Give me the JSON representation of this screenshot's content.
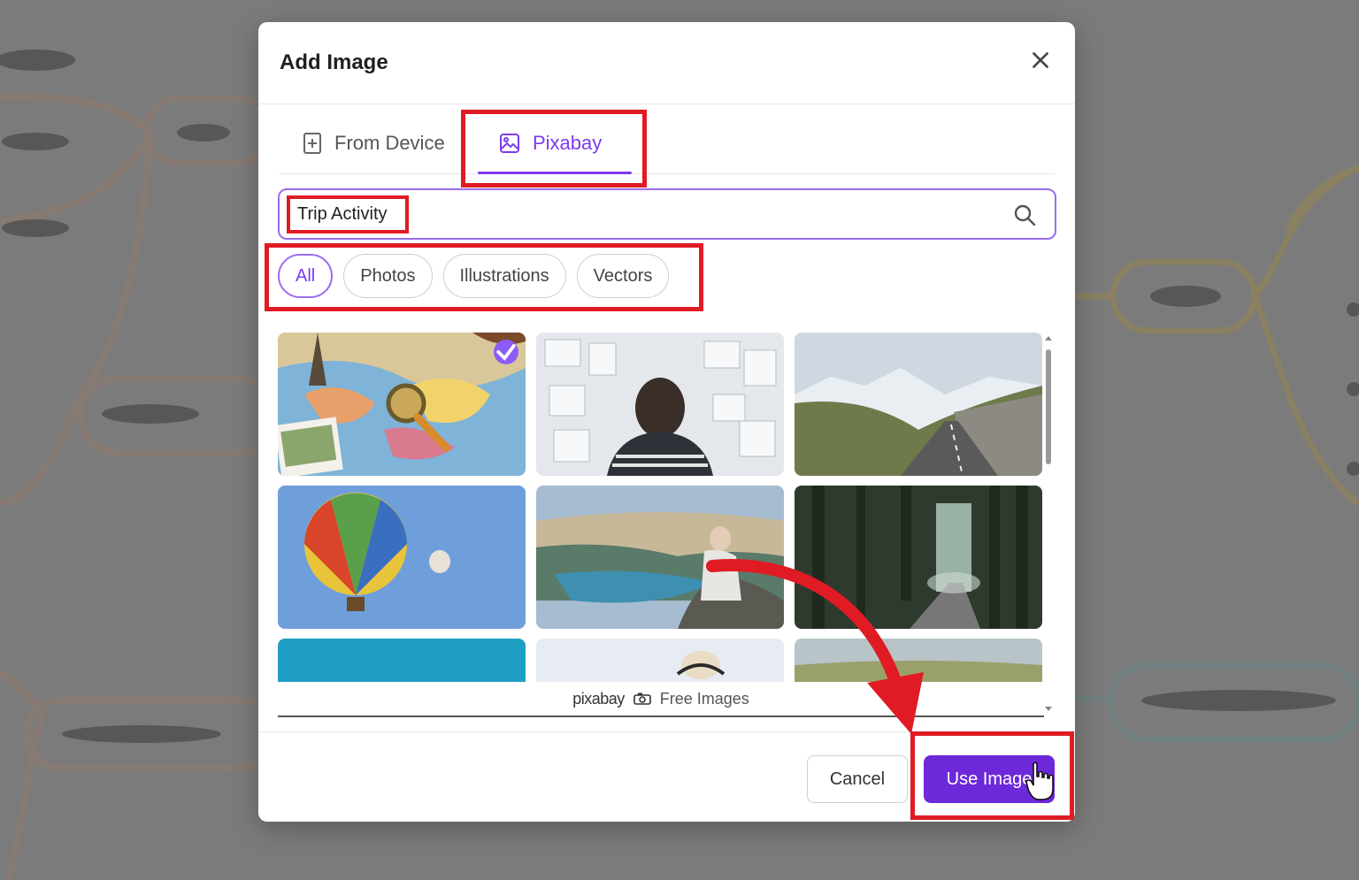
{
  "dialog": {
    "title": "Add Image",
    "tabs": [
      {
        "label": "From Device",
        "active": false
      },
      {
        "label": "Pixabay",
        "active": true
      }
    ]
  },
  "search": {
    "value": "Trip Activity"
  },
  "filters": [
    {
      "label": "All",
      "active": true
    },
    {
      "label": "Photos",
      "active": false
    },
    {
      "label": "Illustrations",
      "active": false
    },
    {
      "label": "Vectors",
      "active": false
    }
  ],
  "attribution": {
    "logo": "pixabay",
    "text": "Free Images"
  },
  "footer": {
    "cancel_label": "Cancel",
    "use_label": "Use Image"
  },
  "colors": {
    "accent": "#7c3aed",
    "primary_button": "#6d28d9",
    "annotation": "#e01b24"
  }
}
